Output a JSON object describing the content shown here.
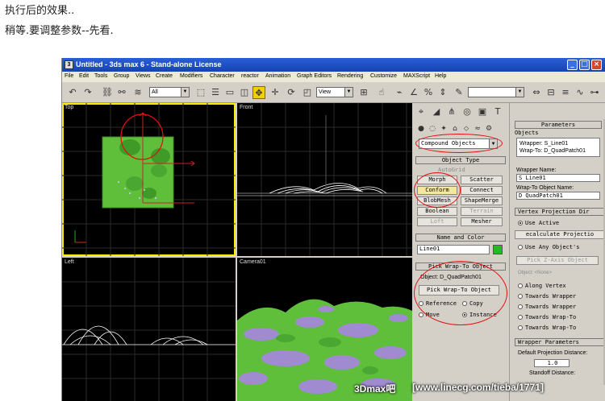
{
  "post": {
    "line1": "执行后的效果..",
    "line2": "稍等.要调整参数--先看."
  },
  "window": {
    "title": "Untitled - 3ds max 6 - Stand-alone License",
    "app_icon": "3ds-max-icon",
    "controls": [
      "_",
      "□",
      "×"
    ]
  },
  "menu": [
    "File",
    "Edit",
    "Tools",
    "Group",
    "Views",
    "Create",
    "Modifiers",
    "Character",
    "reactor",
    "Animation",
    "Graph Editors",
    "Rendering",
    "Customize",
    "MAXScript",
    "Help"
  ],
  "toolbar": {
    "selection_filter": "All",
    "reference_coord": "View"
  },
  "viewports": {
    "top": "Top",
    "front": "Front",
    "left": "Left",
    "camera": "Camera01"
  },
  "command_panel": {
    "category": "Compound Objects",
    "object_type_header": "Object Type",
    "autogrid": "AutoGrid",
    "buttons": [
      "Morph",
      "Scatter",
      "Conform",
      "Connect",
      "BlobMesh",
      "ShapeMerge",
      "Boolean",
      "Terrain",
      "Loft",
      "Mesher"
    ],
    "name_color_header": "Name and Color",
    "object_name": "Line01",
    "object_color": "#22bb22",
    "pick_header": "Pick Wrap-To Object",
    "pick_object_label": "Object: D_QuadPatch01",
    "pick_button": "Pick Wrap-To Object",
    "ref_options": [
      "Reference",
      "Copy",
      "Move",
      "Instance"
    ],
    "ref_selected": "Instance"
  },
  "parameters": {
    "header": "Parameters",
    "objects_label": "Objects",
    "objects_list": [
      "Wrapper: S_Line01",
      "Wrap-To: D_QuadPatch01"
    ],
    "wrapper_name_label": "Wrapper Name:",
    "wrapper_name": "S Line01",
    "wrapto_name_label": "Wrap-To Object Name:",
    "wrapto_name": "D QuadPatch01",
    "vertex_proj_header": "Vertex Projection Dir",
    "use_active": "Use Active",
    "recalc_button": "ecalculate Projectio",
    "use_any": "Use Any Object's",
    "pick_z_axis": "Pick Z-Axis Object",
    "object_none": "Object: <None>",
    "along_vertex": "Along Vertex",
    "towards_options": [
      "Towards Wrapper",
      "Towards Wrapper",
      "Towards Wrap-To",
      "Towards Wrap-To"
    ],
    "wrapper_params_header": "Wrapper Parameters",
    "default_proj_label": "Default Projection Distance:",
    "default_proj_value": "1.0",
    "standoff_label": "Standoff Distance:"
  },
  "watermark": {
    "left": "3Dmax吧",
    "right": "[www.linecg.com/tieba/1771]"
  },
  "colors": {
    "title_bar": "#1e4fc4",
    "terrain_green": "#5fbf3a",
    "terrain_purple": "#a08ad0",
    "active_viewport": "#f4f000",
    "annotation_red": "#e01010"
  }
}
